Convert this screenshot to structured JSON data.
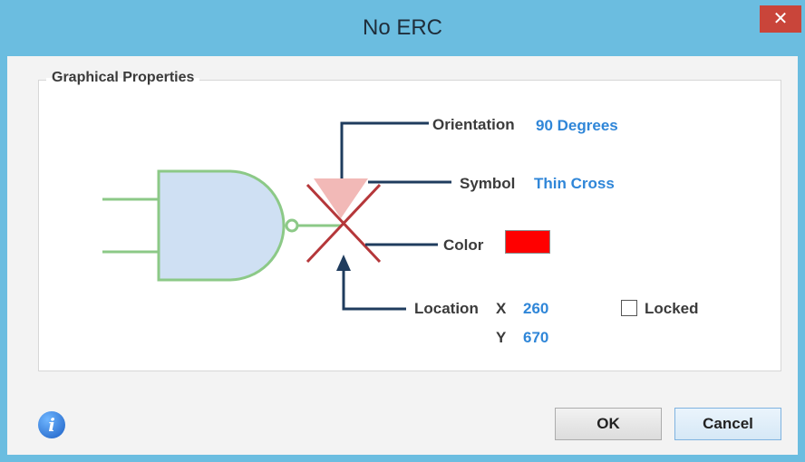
{
  "window": {
    "title": "No ERC",
    "close_glyph": "✕"
  },
  "group": {
    "label": "Graphical Properties"
  },
  "properties": {
    "orientation_label": "Orientation",
    "orientation_value": "90 Degrees",
    "symbol_label": "Symbol",
    "symbol_value": "Thin Cross",
    "color_label": "Color",
    "color_value": "#ff0000",
    "location_label": "Location",
    "x_label": "X",
    "x_value": "260",
    "y_label": "Y",
    "y_value": "670",
    "locked_label": "Locked",
    "locked_checked": false
  },
  "buttons": {
    "ok": "OK",
    "cancel": "Cancel"
  },
  "icons": {
    "info": "info-icon",
    "close": "close-icon"
  },
  "colors": {
    "titlebar": "#6bbde0",
    "gate_fill": "#cfe0f3",
    "gate_stroke": "#8cc987",
    "cross": "#b5373a",
    "triangle": "#f2b9b7",
    "callout": "#1f3c5e"
  }
}
